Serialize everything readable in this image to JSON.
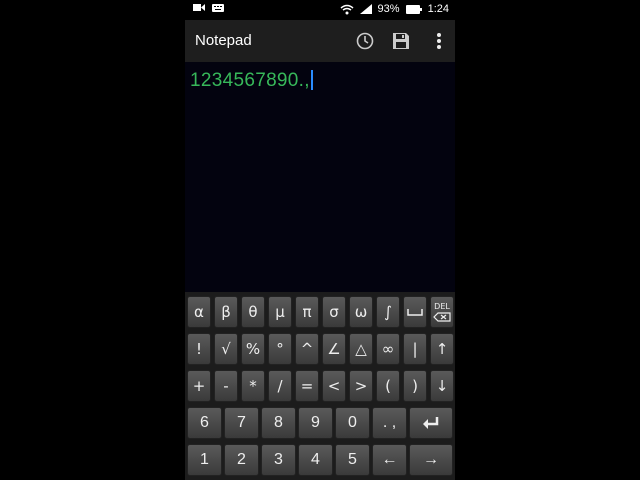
{
  "status_bar": {
    "battery_percent": "93%",
    "time": "1:24"
  },
  "app_bar": {
    "title": "Notepad",
    "icons": [
      "history-icon",
      "save-icon",
      "more-vert-icon"
    ]
  },
  "editor": {
    "text": "1234567890.,"
  },
  "keyboard": {
    "row1": [
      "α",
      "β",
      "θ",
      "μ",
      "π",
      "σ",
      "ω",
      "∫",
      "␣",
      "DEL"
    ],
    "row2": [
      "!",
      "√",
      "%",
      "°",
      "^",
      "∠",
      "△",
      "∞",
      "|",
      "↑"
    ],
    "row3": [
      "+",
      "-",
      "*",
      "/",
      "=",
      "<",
      ">",
      "(",
      ")",
      "↓"
    ],
    "row4": [
      "6",
      "7",
      "8",
      "9",
      "0",
      ". ,",
      "↵"
    ],
    "row5": [
      "1",
      "2",
      "3",
      "4",
      "5",
      "←",
      "→"
    ]
  },
  "colors": {
    "text_green": "#37b85a",
    "caret_blue": "#2a8cff",
    "background": "#03030f"
  }
}
